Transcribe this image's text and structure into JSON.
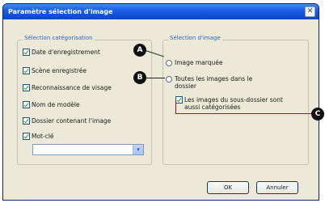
{
  "dialog": {
    "title": "Paramètre sélection d'image",
    "close_glyph": "✕"
  },
  "categorisation": {
    "title": "Sélection catégorisation",
    "items": [
      {
        "label": "Date d'enregistrement",
        "checked": true
      },
      {
        "label": "Scène enregistrée",
        "checked": true
      },
      {
        "label": "Reconnaissance de visage",
        "checked": true
      },
      {
        "label": "Nom de modèle",
        "checked": true
      },
      {
        "label": "Dossier contenant l'image",
        "checked": true
      },
      {
        "label": "Mot-clé",
        "checked": true
      }
    ],
    "keyword_value": "",
    "dropdown_icon": "chevron-down-icon"
  },
  "image_selection": {
    "title": "Sélection d'image",
    "radio_marked": "Image marquée",
    "radio_all": "Toutes les images dans le dossier",
    "subfolder_checkbox": "Les images du sous-dossier sont aussi catégorisées"
  },
  "buttons": {
    "ok": "OK",
    "cancel": "Annuler"
  },
  "callouts": {
    "a": "A",
    "b": "B",
    "c": "C"
  },
  "colors": {
    "titlebar": "#0b46c6",
    "group_title": "#2c63c8",
    "check": "#21a121",
    "callout_leader": "#cc0000"
  }
}
